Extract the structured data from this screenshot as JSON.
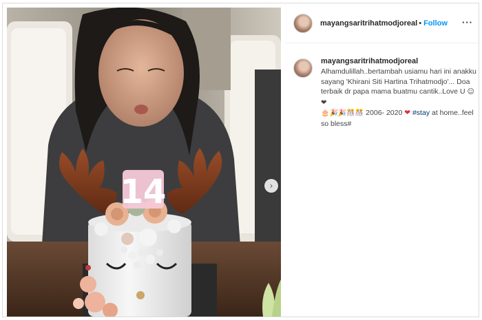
{
  "post": {
    "username": "mayangsaritrihatmodjoreal",
    "dot": "•",
    "follow_label": "Follow",
    "more_label": "···",
    "next_icon_glyph": "›",
    "caption": {
      "text_main": "Alhamdulillah..bertambah usiamu hari ini anakku sayang 'Khirani Siti Hartina Trihatmodjo'... Doa terbaik dr papa mama buatmu cantik..Love U ",
      "emoji_love": "☺❤",
      "emoji_row": "🎂🎉🎉🎊🎊",
      "years": " 2006- 2020 ",
      "heart": "❤",
      "hashtag": "#stay",
      "text_end": " at home..feel so bless#"
    },
    "candle_text": "14"
  }
}
